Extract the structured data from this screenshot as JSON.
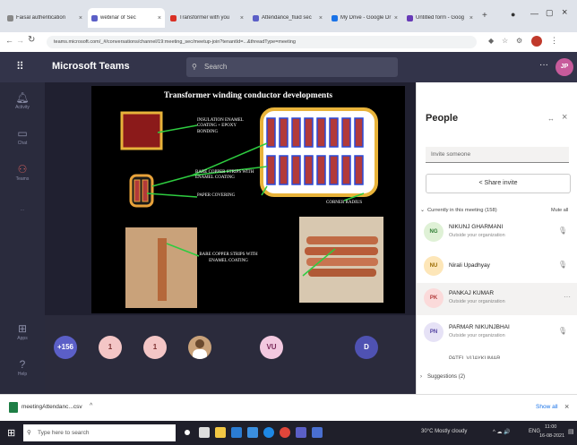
{
  "browser": {
    "tabs": [
      {
        "label": "Faisal authentication",
        "color": "#888888"
      },
      {
        "label": "webinar of Sec",
        "color": "#5b5fc7"
      },
      {
        "label": "Transformer with you",
        "color": "#d93025"
      },
      {
        "label": "Attendance_fluid sec",
        "color": "#5b5fc7"
      },
      {
        "label": "My Drive - Google Dr",
        "color": "#1a73e8"
      },
      {
        "label": "Untitled form - Goog",
        "color": "#673ab7"
      }
    ],
    "new_tab": "+",
    "url": "teams.microsoft.com/_#/conversations/channel/19:meeting_sec/meetup-join?tenantId=...&threadType=meeting"
  },
  "teams": {
    "app_title": "Microsoft Teams",
    "search_placeholder": "Search",
    "avatar_initials": "JP",
    "more": "···"
  },
  "rail": [
    {
      "label": "Activity",
      "icon": "bell-icon"
    },
    {
      "label": "Chat",
      "icon": "chat-icon"
    },
    {
      "label": "Teams",
      "icon": "teams-icon"
    },
    {
      "label": "···",
      "icon": "more-icon"
    },
    {
      "label": "Apps",
      "icon": "apps-icon"
    },
    {
      "label": "Help",
      "icon": "help-icon"
    }
  ],
  "slide": {
    "title": "Transformer winding conductor developments",
    "labels": {
      "insulation": "INSULATION ENAMEL COATING + EPOXY BONDING",
      "bare_strips": "BARE COPPER STRIPS WITH ENAMEL COATING",
      "paper": "PAPER COVERING",
      "corner": "CORNER RADIUS",
      "bare_strips_2": "BARE COPPER STRIPS WITH ENAMEL COATING"
    }
  },
  "participants": [
    {
      "label": "+156",
      "bg": "#5b5fc7",
      "fg": "#ffffff"
    },
    {
      "label": "1",
      "bg": "#f4c6c6",
      "fg": "#7a2f2f"
    },
    {
      "label": "1",
      "bg": "#f4c6c6",
      "fg": "#7a2f2f"
    },
    {
      "label": "",
      "bg": "#c9a27a",
      "fg": "#ffffff"
    },
    {
      "label": "VU",
      "bg": "#f3c9e0",
      "fg": "#7b2a5a"
    },
    {
      "label": "D",
      "bg": "#4f52b2",
      "fg": "#ffffff"
    }
  ],
  "people": {
    "title": "People",
    "invite_placeholder": "Invite someone",
    "share_invite": "Share invite",
    "currently": "Currently in this meeting (158)",
    "mute_all": "Mute all",
    "list": [
      {
        "initials": "NG",
        "name": "NIKUNJ GHARMANI",
        "sub": "Outside your organization",
        "bg": "#dff1d6",
        "fg": "#2e7d32"
      },
      {
        "initials": "NU",
        "name": "Nirali Upadhyay",
        "sub": "",
        "bg": "#fde6b8",
        "fg": "#9a6b00"
      },
      {
        "initials": "PK",
        "name": "PANKAJ KUMAR",
        "sub": "Outside your organization",
        "bg": "#fbdada",
        "fg": "#b23a3a"
      },
      {
        "initials": "PN",
        "name": "PARMAR NIKUNJBHAI",
        "sub": "Outside your organization",
        "bg": "#e6e2f6",
        "fg": "#4f3fa0"
      }
    ],
    "partial_name": "PATEL VIJAYKUMAR",
    "suggestions": "Suggestions (2)"
  },
  "downloads": {
    "file": "meetingAttendanc...csv",
    "show_all": "Show all"
  },
  "taskbar": {
    "search_placeholder": "Type here to search",
    "weather": "30°C Mostly cloudy",
    "lang": "ENG",
    "time": "11:00",
    "date": "16-08-2021"
  }
}
